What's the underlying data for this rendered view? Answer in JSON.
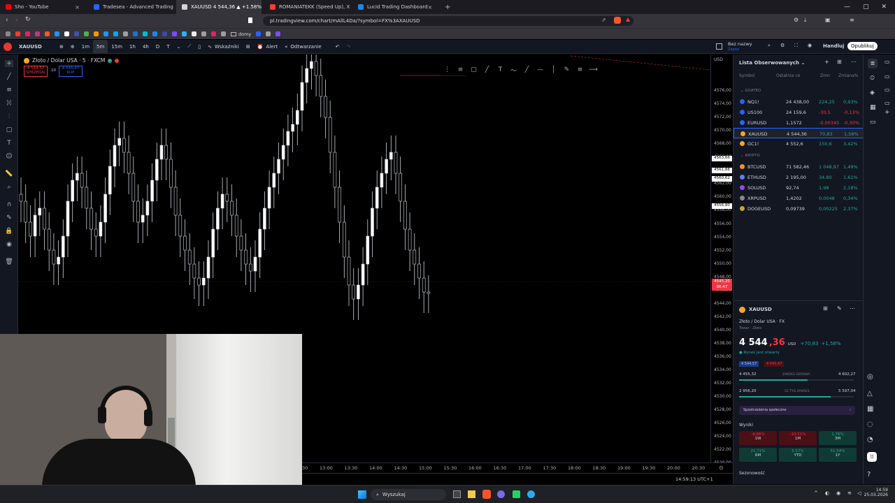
{
  "browser": {
    "tabs": [
      {
        "title": "Sho - YouTube",
        "color": "#ff0000",
        "active": false
      },
      {
        "title": "Tradesea - Advanced Trading Dashbo...",
        "color": "#2962ff",
        "active": false
      },
      {
        "title": "XAUUSD 4 544,36 ▲ +1.58% Bez...",
        "color": "#d1d4dc",
        "active": true
      },
      {
        "title": "ROMANIATEKK (Speed Up), XISOW",
        "color": "#ff3b30",
        "active": false
      },
      {
        "title": "Lucid Trading Dashboard",
        "color": "#1e88e5",
        "active": false
      }
    ],
    "url": "pl.tradingview.com/chart/mAllL4Da/?symbol=FX%3AXAUUSD",
    "bookmarks_folder": "domy"
  },
  "toolbar": {
    "symbol": "XAUUSD",
    "intervals": [
      "1m",
      "5m",
      "15m",
      "1h",
      "4h",
      "D",
      "T"
    ],
    "indicators": "Wskaźniki",
    "alert": "Alert",
    "replay": "Odtwarzanie",
    "layout_name": "Bez nazwy",
    "layout_sub": "Zapisz",
    "trade": "Handluj",
    "publish": "Opublikuj"
  },
  "chart": {
    "title": "Złoto / Dolar USA · 5 · FXCM",
    "sell_price": "4 544,57",
    "sell_label": "SPRZEDAJ",
    "spread": "10",
    "buy_price": "4 545,47",
    "buy_label": "KUP",
    "currency": "USD",
    "price_labels": [
      "4576,00",
      "4574,00",
      "4572,00",
      "4570,00",
      "4568,00",
      "4566,00",
      "4564,00",
      "4562,00",
      "4560,00",
      "4558,00",
      "4556,00",
      "4554,00",
      "4552,00",
      "4550,00",
      "4548,00",
      "4546,00",
      "4544,00",
      "4542,00",
      "4540,00",
      "4538,00",
      "4536,00",
      "4534,00",
      "4532,00",
      "4530,00",
      "4528,00",
      "4526,00",
      "4524,00",
      "4522,00",
      "4520,00"
    ],
    "marker_labels": [
      "4563,66",
      "4561,88",
      "4560,62",
      "4556,80"
    ],
    "current_price": "4545,20",
    "countdown": "00:47",
    "time_labels": [
      "13:00",
      "13:30",
      "14:00",
      "14:30",
      "15:00",
      "15:30",
      "16:00",
      "16:30",
      "17:00",
      "17:30",
      "18:00",
      "18:30",
      "19:00",
      "19:30",
      "20:00",
      "20:30"
    ],
    "partial_time_label": "30",
    "clock": "14:59:13 UTC+1"
  },
  "watchlist": {
    "title": "Lista Obserwowanych",
    "columns": [
      "Symbol",
      "Ostatnia ce",
      "Zmn",
      "Zmiana%"
    ],
    "section1": "GOATED",
    "section2": "KRYPTO",
    "rows1": [
      {
        "symbol": "NQ1!",
        "last": "24 438,00",
        "chg": "224,25",
        "pct": "0,93%",
        "dir": "pos",
        "icon": "#2962ff"
      },
      {
        "symbol": "US100",
        "last": "24 159,6",
        "chg": "-30,5",
        "pct": "-0,13%",
        "dir": "neg",
        "icon": "#2962ff"
      },
      {
        "symbol": "EURUSD",
        "last": "1,1572",
        "chg": "-0,00345",
        "pct": "-0,30%",
        "dir": "neg",
        "icon": "#2962ff"
      },
      {
        "symbol": "XAUUSD",
        "last": "4 544,36",
        "chg": "70,83",
        "pct": "1,58%",
        "dir": "pos",
        "icon": "#f5a623"
      },
      {
        "symbol": "GC1!",
        "last": "4 552,6",
        "chg": "150,6",
        "pct": "3,42%",
        "dir": "pos",
        "icon": "#f5a623"
      }
    ],
    "rows2": [
      {
        "symbol": "BTCUSD",
        "last": "71 582,46",
        "chg": "1 048,97",
        "pct": "1,49%",
        "dir": "pos",
        "icon": "#f7931a"
      },
      {
        "symbol": "ETHUSD",
        "last": "2 195,00",
        "chg": "34,80",
        "pct": "1,61%",
        "dir": "pos",
        "icon": "#627eea"
      },
      {
        "symbol": "SOLUSD",
        "last": "92,74",
        "chg": "1,98",
        "pct": "2,18%",
        "dir": "pos",
        "icon": "#9945ff"
      },
      {
        "symbol": "XRPUSD",
        "last": "1,4202",
        "chg": "0,0048",
        "pct": "0,34%",
        "dir": "pos",
        "icon": "#888888"
      },
      {
        "symbol": "DOGEUSD",
        "last": "0,09739",
        "chg": "0,00225",
        "pct": "2,37%",
        "dir": "pos",
        "icon": "#c2a633"
      }
    ]
  },
  "detail": {
    "symbol": "XAUUSD",
    "name": "Złoto / Dolar USA · FX",
    "category": "Towar · Złoto",
    "price_main": "4 544",
    "price_frac": ",36",
    "currency": "USD",
    "change": "+70,83",
    "change_pct": "+1,58%",
    "market_status": "Rynek jest otwarty",
    "bid_chip": "4 544,57",
    "ask_chip": "4 545,47",
    "day_low": "4 455,32",
    "day_label": "ZAKRES DZIENNY",
    "day_high": "4 602,27",
    "day_fill": 0.6,
    "week_low": "2 956,20",
    "week_label": "52 TYG ZAKRES",
    "week_high": "5 597,04",
    "week_fill": 0.8,
    "community": "Spostrzeżenia społeczne",
    "results_label": "Wyniki",
    "results": [
      {
        "value": "-8,66%",
        "period": "1W",
        "dir": "neg"
      },
      {
        "value": "-10,51%",
        "period": "1M",
        "dir": "neg"
      },
      {
        "value": "1,76%",
        "period": "3M",
        "dir": "pos"
      },
      {
        "value": "21,71%",
        "period": "6M",
        "dir": "pos"
      },
      {
        "value": "5,57%",
        "period": "YTD",
        "dir": "pos"
      },
      {
        "value": "51,54%",
        "period": "1Y",
        "dir": "pos"
      }
    ],
    "seasonality": "Sezonowość"
  },
  "taskbar": {
    "search": "Wyszukaj",
    "time": "14:59",
    "date": "25.03.2026"
  },
  "colors": {
    "up": "#26a69a",
    "down": "#f23645",
    "accent": "#2962ff"
  }
}
